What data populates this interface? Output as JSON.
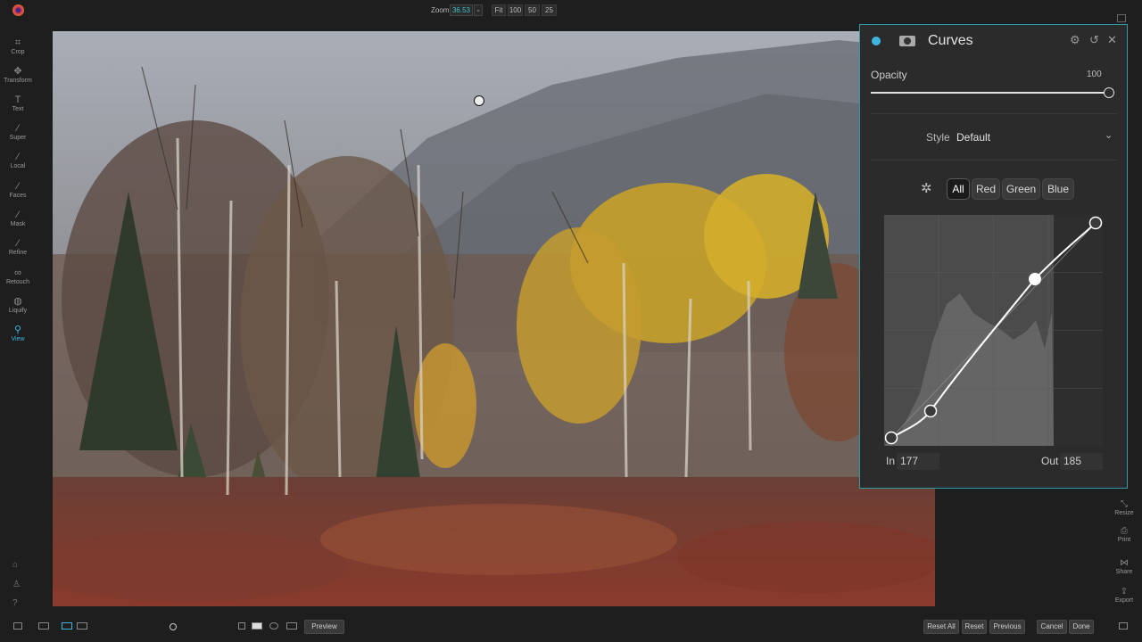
{
  "topbar": {
    "zoom_label": "Zoom",
    "zoom_value": "36.53",
    "zoom_buttons": [
      "Fit",
      "100",
      "50",
      "25"
    ]
  },
  "left_tools": [
    {
      "label": "Crop",
      "icon": "crop-icon"
    },
    {
      "label": "Transform",
      "icon": "move-icon"
    },
    {
      "label": "Text",
      "icon": "text-icon"
    },
    {
      "label": "Super",
      "icon": "super-icon"
    },
    {
      "label": "Local",
      "icon": "brush-icon"
    },
    {
      "label": "Faces",
      "icon": "faces-icon"
    },
    {
      "label": "Mask",
      "icon": "mask-icon"
    },
    {
      "label": "Refine",
      "icon": "refine-icon"
    },
    {
      "label": "Retouch",
      "icon": "retouch-icon"
    },
    {
      "label": "Liquify",
      "icon": "liquify-icon"
    },
    {
      "label": "View",
      "icon": "magnifier-icon",
      "active": true
    }
  ],
  "panel": {
    "title": "Curves",
    "opacity_label": "Opacity",
    "opacity_value": "100",
    "opacity_fraction": 1.0,
    "style_label": "Style",
    "style_value": "Default",
    "channels": [
      "All",
      "Red",
      "Green",
      "Blue"
    ],
    "selected_channel": "All",
    "in_label": "In",
    "in_value": "177",
    "out_label": "Out",
    "out_value": "185"
  },
  "right_tools": [
    {
      "label": "Resize",
      "icon": "resize-icon"
    },
    {
      "label": "Print",
      "icon": "print-icon"
    },
    {
      "label": "Share",
      "icon": "share-icon"
    },
    {
      "label": "Export",
      "icon": "export-icon"
    }
  ],
  "bottom": {
    "preview_label": "Preview",
    "buttons": [
      "Reset All",
      "Reset",
      "Previous",
      "Cancel",
      "Done"
    ]
  },
  "colors": {
    "accent": "#3fb6e0",
    "panel_border": "#2f9aa8",
    "zoom_value": "#3fc3c9"
  }
}
